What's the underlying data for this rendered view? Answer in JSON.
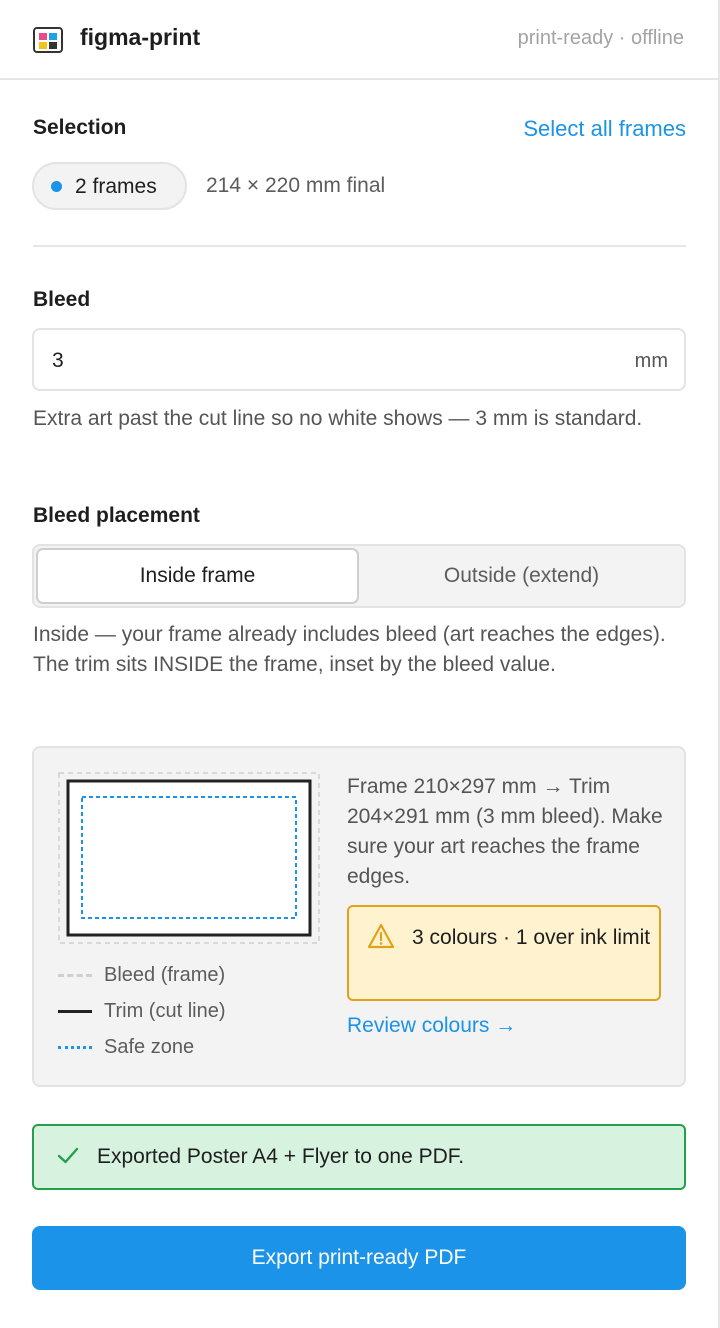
{
  "header": {
    "icon": "color-swatch-icon",
    "title": "figma-print",
    "status": "print-ready · offline"
  },
  "selection": {
    "label": "Selection",
    "select_all_link": "Select all frames",
    "chip_label": "2 frames",
    "dimensions": "214 × 220 mm final"
  },
  "bleed": {
    "label": "Bleed",
    "value": "3",
    "unit": "mm",
    "help": "Extra art past the cut line so no white shows — 3 mm is standard."
  },
  "placement": {
    "label": "Bleed placement",
    "options": [
      "Inside frame",
      "Outside (extend)"
    ],
    "selected": "Inside frame",
    "help": "Inside — your frame already includes bleed (art reaches the edges). The trim sits INSIDE the frame, inset by the bleed value."
  },
  "preview": {
    "legend": [
      "Bleed (frame)",
      "Trim (cut line)",
      "Safe zone"
    ],
    "description": "Frame 210×297 mm → Trim 204×291 mm (3 mm bleed). Make sure your art reaches the frame edges.",
    "warning": "3 colours · 1 over ink limit",
    "review_link": "Review colours →"
  },
  "toast": {
    "message": "Exported Poster A4 + Flyer to one PDF."
  },
  "export_button": "Export print-ready PDF",
  "colors": {
    "accent": "#1a93e8",
    "warning_border": "#e0a21a",
    "warning_bg": "#fff3cf",
    "success_border": "#23a04b",
    "success_bg": "#d7f3e0"
  }
}
